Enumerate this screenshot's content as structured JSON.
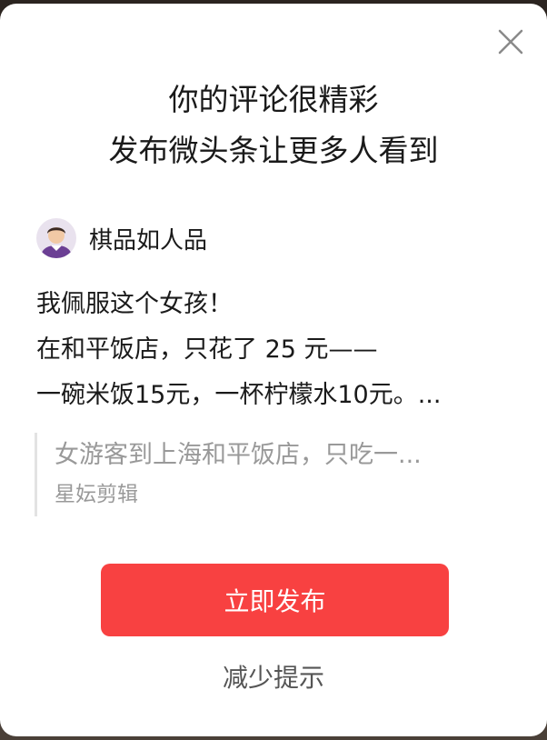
{
  "dialog": {
    "headline_line1": "你的评论很精彩",
    "headline_line2": "发布微头条让更多人看到",
    "close_icon": "close-icon"
  },
  "author": {
    "avatar_icon": "avatar",
    "name": "棋品如人品"
  },
  "comment": {
    "line1": "我佩服这个女孩！",
    "line2": "在和平饭店，只花了 25 元——",
    "line3": "一碗米饭15元，一杯柠檬水10元。..."
  },
  "quote": {
    "title": "女游客到上海和平饭店，只吃一...",
    "source": "星妘剪辑"
  },
  "actions": {
    "publish_label": "立即发布",
    "reduce_label": "减少提示"
  },
  "colors": {
    "primary": "#f84141",
    "text": "#1a1a1a",
    "muted": "#999999"
  }
}
